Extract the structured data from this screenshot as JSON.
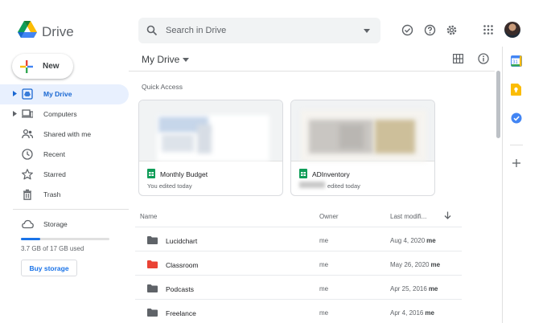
{
  "header": {
    "brand": "Drive",
    "search_placeholder": "Search in Drive",
    "icons": [
      "offline-check-icon",
      "help-icon",
      "settings-icon",
      "apps-grid-icon"
    ]
  },
  "sidebar": {
    "new_label": "New",
    "items": [
      {
        "label": "My Drive",
        "icon": "my-drive-icon",
        "active": true
      },
      {
        "label": "Computers",
        "icon": "computers-icon"
      },
      {
        "label": "Shared with me",
        "icon": "shared-icon"
      },
      {
        "label": "Recent",
        "icon": "clock-icon"
      },
      {
        "label": "Starred",
        "icon": "star-icon"
      },
      {
        "label": "Trash",
        "icon": "trash-icon"
      }
    ],
    "storage_label": "Storage",
    "storage_used_text": "3.7 GB of 17 GB used",
    "storage_fraction": 0.22,
    "buy_storage_label": "Buy storage"
  },
  "main": {
    "title": "My Drive",
    "quick_access_label": "Quick Access",
    "cards": [
      {
        "title": "Monthly Budget",
        "subtitle": "You edited today",
        "icon": "sheets-icon"
      },
      {
        "title": "ADInventory",
        "subtitle": "edited today",
        "icon": "sheets-icon"
      }
    ],
    "columns": {
      "name": "Name",
      "owner": "Owner",
      "modified": "Last modifi..."
    },
    "rows": [
      {
        "name": "Lucidchart",
        "owner": "me",
        "modified": "Aug 4, 2020",
        "modified_by": "me",
        "color": "#5f6368"
      },
      {
        "name": "Classroom",
        "owner": "me",
        "modified": "May 26, 2020",
        "modified_by": "me",
        "color": "#ea4335"
      },
      {
        "name": "Podcasts",
        "owner": "me",
        "modified": "Apr 25, 2016",
        "modified_by": "me",
        "color": "#5f6368"
      },
      {
        "name": "Freelance",
        "owner": "me",
        "modified": "Apr 4, 2016",
        "modified_by": "me",
        "color": "#5f6368"
      }
    ]
  },
  "right_panel": {
    "icons": [
      "calendar-icon",
      "keep-icon",
      "tasks-icon",
      "add-addon-icon"
    ]
  },
  "colors": {
    "accent": "#1a73e8",
    "active_bg": "#e8f0fe",
    "sheets_green": "#0f9d58"
  }
}
